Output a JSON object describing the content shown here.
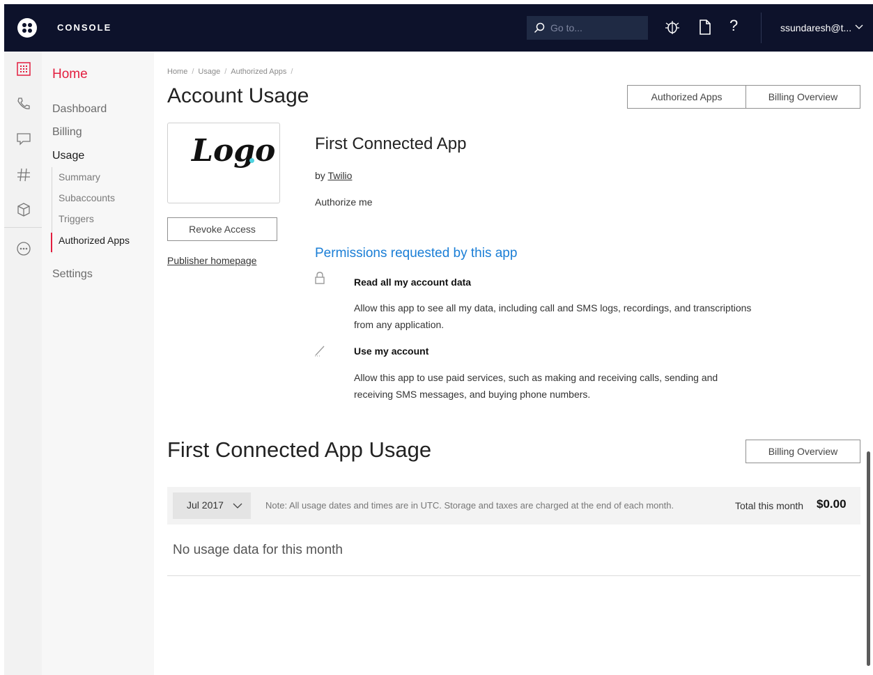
{
  "topbar": {
    "console_label": "CONSOLE",
    "search_placeholder": "Go to...",
    "help_glyph": "?",
    "user": "ssundaresh@t...",
    "icons": [
      "twilio-logo-icon",
      "search-icon",
      "bug-icon",
      "document-icon",
      "help-icon",
      "chevron-down-icon"
    ]
  },
  "rail": {
    "icons": [
      "dashboard-icon",
      "phone-icon",
      "chat-icon",
      "hash-icon",
      "cube-icon",
      "more-icon"
    ]
  },
  "sidebar": {
    "home": "Home",
    "dashboard": "Dashboard",
    "billing": "Billing",
    "usage": "Usage",
    "sub_items": [
      "Summary",
      "Subaccounts",
      "Triggers",
      "Authorized Apps"
    ],
    "settings": "Settings"
  },
  "breadcrumb": [
    "Home",
    "Usage",
    "Authorized Apps"
  ],
  "page": {
    "title": "Account Usage",
    "authorized_apps_btn": "Authorized Apps",
    "billing_overview_btn": "Billing Overview"
  },
  "app": {
    "logo_text": "Logo",
    "name": "First Connected App",
    "by_prefix": "by",
    "publisher": "Twilio",
    "description": "Authorize me",
    "revoke_btn": "Revoke Access",
    "publisher_link": "Publisher homepage"
  },
  "permissions": {
    "title": "Permissions requested by this app",
    "items": [
      {
        "icon": "lock-icon",
        "heading": "Read all my account data",
        "desc1": "Allow this app to see all my data, including call and SMS logs, recordings, and transcriptions",
        "desc2": "from any application."
      },
      {
        "icon": "pencil-icon",
        "heading": "Use my account",
        "desc1": "Allow this app to use paid services, such as making and receiving calls, sending and",
        "desc2": "receiving SMS messages, and buying phone numbers."
      }
    ]
  },
  "usage": {
    "title": "First Connected App Usage",
    "billing_overview_btn": "Billing Overview",
    "month": "Jul 2017",
    "note": "Note: All usage dates and times are in UTC. Storage and taxes are charged at the end of each month.",
    "total_label": "Total this month",
    "total_value": "$0.00",
    "empty": "No usage data for this month"
  },
  "colors": {
    "topbar": "#0d122b",
    "accent_red": "#e31e3f",
    "link_blue": "#1a7ed6"
  }
}
